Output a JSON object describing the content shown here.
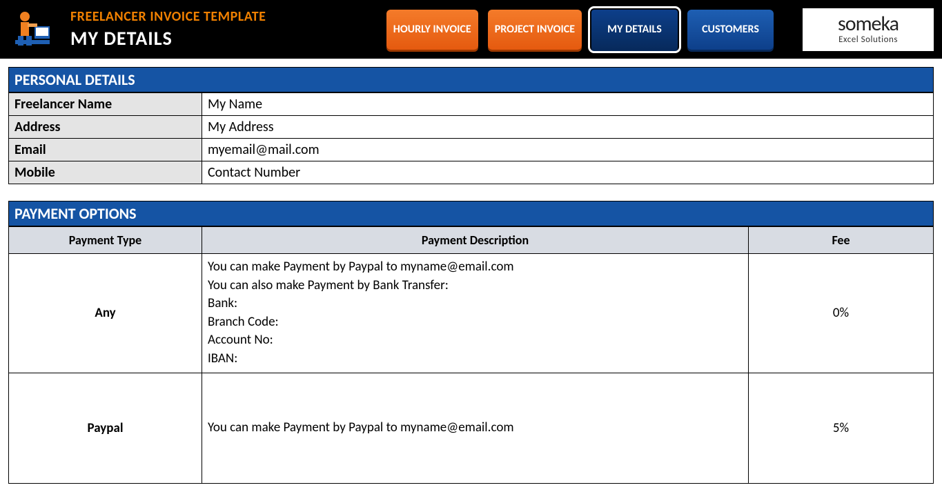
{
  "header": {
    "template_title": "FREELANCER INVOICE TEMPLATE",
    "page_title": "MY DETAILS",
    "tabs": {
      "hourly": "HOURLY INVOICE",
      "project": "PROJECT INVOICE",
      "mydetails": "MY DETAILS",
      "customers": "CUSTOMERS"
    },
    "brand_main": "someka",
    "brand_sub": "Excel Solutions"
  },
  "personal": {
    "section_title": "PERSONAL DETAILS",
    "rows": {
      "name_label": "Freelancer Name",
      "name_value": "My Name",
      "address_label": "Address",
      "address_value": "My Address",
      "email_label": "Email",
      "email_value": "myemail@mail.com",
      "mobile_label": "Mobile",
      "mobile_value": "Contact Number"
    }
  },
  "payment": {
    "section_title": "PAYMENT OPTIONS",
    "headers": {
      "type": "Payment Type",
      "desc": "Payment Description",
      "fee": "Fee"
    },
    "rows": [
      {
        "type": "Any",
        "desc": "You can make Payment by Paypal to myname@email.com\nYou can also make Payment by Bank Transfer:\nBank:\nBranch Code:\nAccount No:\nIBAN:",
        "fee": "0%"
      },
      {
        "type": "Paypal",
        "desc": "You can make Payment by Paypal to myname@email.com",
        "fee": "5%"
      }
    ]
  }
}
